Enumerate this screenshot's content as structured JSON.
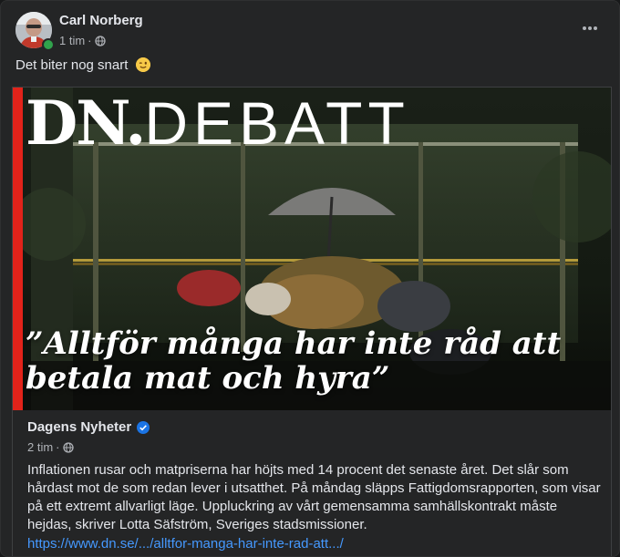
{
  "post": {
    "author": "Carl Norberg",
    "time": "1 tim",
    "separator": "·",
    "audience_icon": "globe-icon",
    "online_status": "online",
    "text": "Det biter nog snart",
    "emoji": "winking-face",
    "more_icon": "more-options-icon"
  },
  "link_preview": {
    "image": {
      "brand_bold": "DN.",
      "brand_light": "DEBATT",
      "headline": "”Alltför många har inte råd att betala mat och hyra”",
      "accent_color": "#e2231a"
    },
    "source": "Dagens Nyheter",
    "verified": true,
    "time": "2 tim",
    "separator": "·",
    "description": "Inflationen rusar och matpriserna har höjts med 14 procent det senaste året. Det slår som hårdast mot de som redan lever i utsatthet. På måndag släpps Fattigdomsrapporten, som visar på ett extremt allvarligt läge. Uppluckring av vårt gemensamma samhällskontrakt måste hejdas, skriver Lotta Säfström, Sveriges stadsmissioner.",
    "url": "https://www.dn.se/.../alltfor-manga-har-inte-rad-att.../"
  },
  "colors": {
    "background": "#242526",
    "text_primary": "#e4e6eb",
    "text_secondary": "#b0b3b8",
    "link": "#4599ff",
    "verified_badge": "#1b74e4",
    "online": "#31a24c"
  }
}
